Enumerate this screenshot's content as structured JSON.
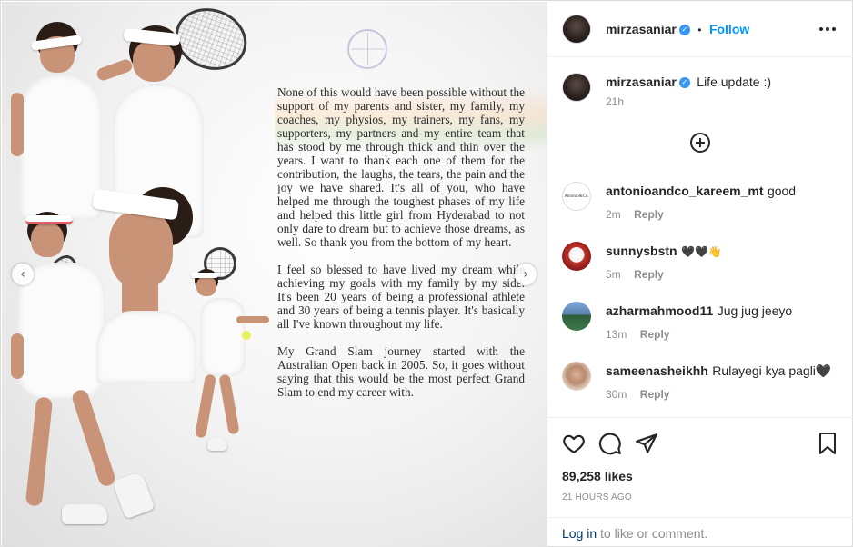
{
  "post": {
    "paragraphs": [
      "None of this would have been possible without the support of my parents and sister, my family, my coaches, my physios, my trainers, my fans, my supporters, my partners and my entire team that has stood by me through thick and thin over the years. I want to thank each one of them for the contribution, the laughs, the tears, the pain and the joy we have shared. It's all of you, who have helped me through the toughest phases of my life and helped this little girl from Hyderabad to not only dare to dream but to achieve those dreams, as well. So thank you from the bottom of my heart.",
      "I feel so blessed to have lived my dream while achieving my goals with my family by my side. It's been 20 years of being a professional athlete and 30 years of being a tennis player. It's basically all I've known throughout my life.",
      "My Grand Slam journey started with the Australian Open back in 2005. So, it goes without saying that this would be the most perfect Grand Slam to end my career with."
    ],
    "nav_prev_icon": "chevron-left-icon",
    "nav_next_icon": "chevron-right-icon"
  },
  "header": {
    "username": "mirzasaniar",
    "dot": "•",
    "follow_label": "Follow",
    "more_icon": "more-options-icon"
  },
  "caption": {
    "username": "mirzasaniar",
    "text": "Life update :)",
    "time": "21h"
  },
  "load_more_icon": "plus-circle-icon",
  "comments": [
    {
      "username": "antonioandco_kareem_mt",
      "text": "good",
      "time": "2m",
      "reply": "Reply",
      "avatar_text": "Antonio&Co."
    },
    {
      "username": "sunnysbstn",
      "text": "🖤🖤👋",
      "time": "5m",
      "reply": "Reply",
      "avatar_text": ""
    },
    {
      "username": "azharmahmood11",
      "text": "Jug jug jeeyo",
      "time": "13m",
      "reply": "Reply",
      "avatar_text": ""
    },
    {
      "username": "sameenasheikhh",
      "text": "Rulayegi kya pagli🖤",
      "time": "30m",
      "reply": "Reply",
      "avatar_text": ""
    }
  ],
  "actions": {
    "like_icon": "heart-icon",
    "comment_icon": "comment-icon",
    "share_icon": "paper-plane-icon",
    "save_icon": "bookmark-icon"
  },
  "likes": "89,258 likes",
  "posted": "21 HOURS AGO",
  "login": {
    "link": "Log in",
    "rest": " to like or comment."
  },
  "colors": {
    "link_blue": "#0095f6",
    "verified_blue": "#3897f0",
    "muted": "#8e8e8e",
    "text": "#262626",
    "login_link": "#00376b"
  }
}
